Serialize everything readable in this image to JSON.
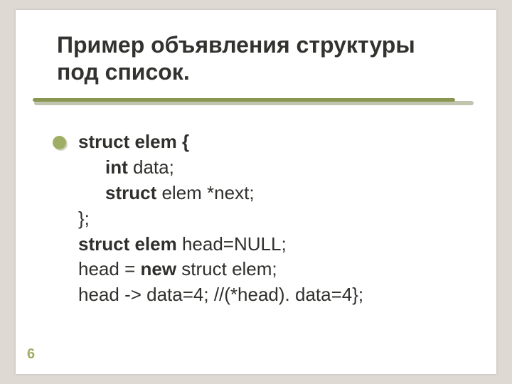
{
  "title_line1": "Пример объявления структуры",
  "title_line2": "под список.",
  "code": {
    "l1_kw": "struct elem {",
    "l2_kw": "int",
    "l2_rest": " data;",
    "l3_kw": "struct",
    "l3_rest": " elem *next;",
    "l4": "};",
    "l5_kw": "struct elem",
    "l5_rest": " head=NULL;",
    "l6_a": "head = ",
    "l6_kw": "new",
    "l6_b": " struct elem;",
    "l7": "head -> data=4; //(*head). data=4};"
  },
  "page_number": "6"
}
